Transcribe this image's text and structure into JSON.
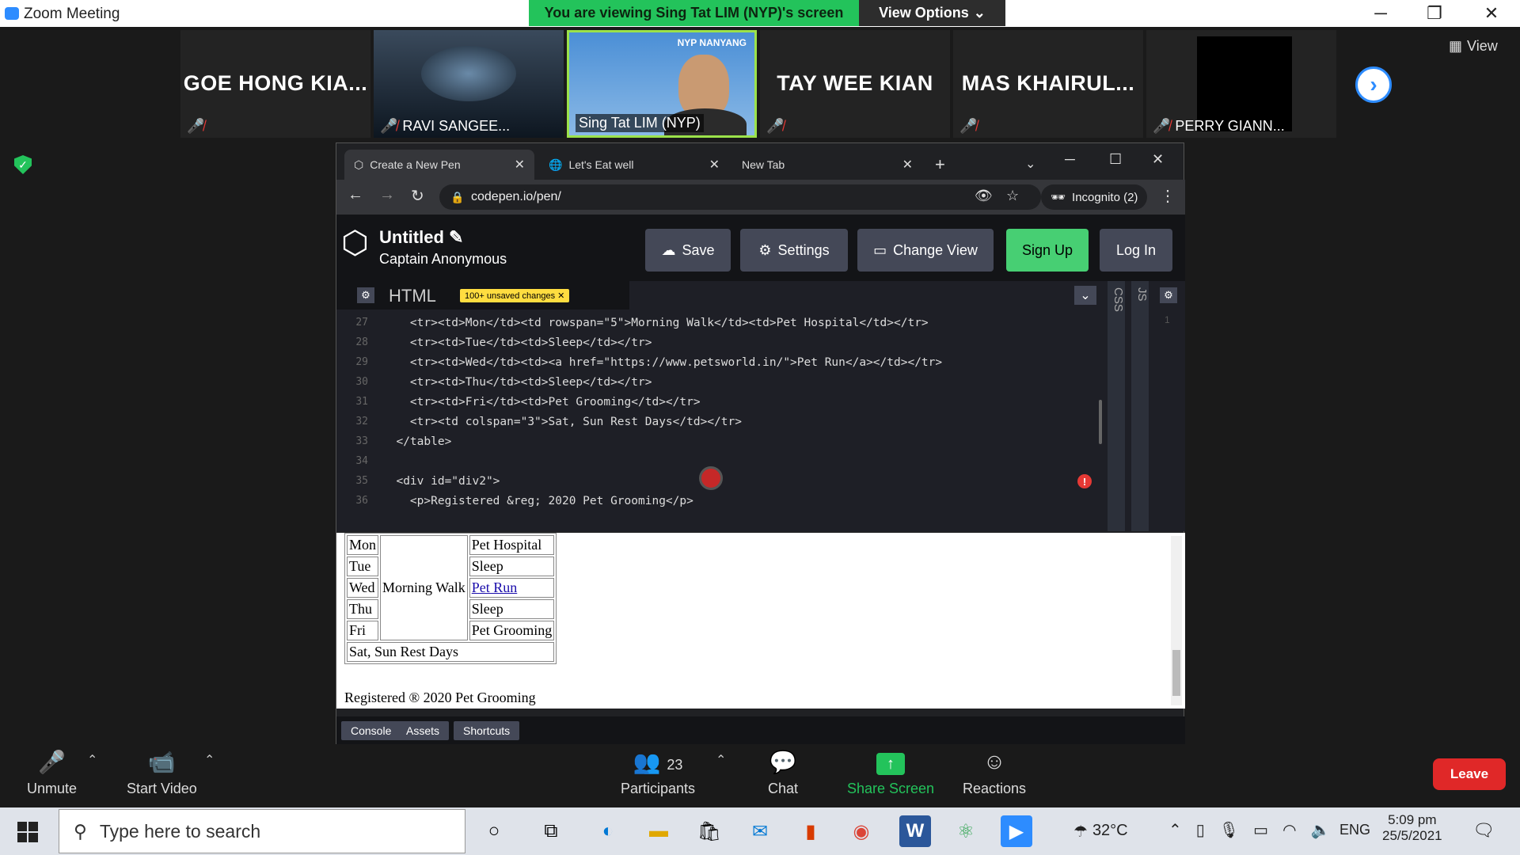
{
  "window": {
    "title": "Zoom Meeting",
    "min": "─",
    "max": "❐",
    "close": "✕"
  },
  "share": {
    "banner": "You are viewing Sing Tat LIM (NYP)'s screen",
    "view_options": "View Options"
  },
  "gallery": {
    "participants": [
      {
        "name": "GOE HONG KIA...",
        "muted": true
      },
      {
        "name": "RAVI SANGEE...",
        "muted": true
      },
      {
        "name": "Sing Tat LIM (NYP)",
        "muted": false
      },
      {
        "name": "TAY WEE KIAN",
        "muted": true
      },
      {
        "name": "MAS KHAIRUL...",
        "muted": true
      },
      {
        "name": "PERRY GIANN...",
        "muted": true
      }
    ],
    "view_label": "View",
    "logo_text": "NYP NANYANG"
  },
  "browser": {
    "tabs": [
      {
        "label": "Create a New Pen",
        "active": true
      },
      {
        "label": "Let's Eat well"
      },
      {
        "label": "New Tab"
      }
    ],
    "url": "codepen.io/pen/",
    "incognito": "Incognito (2)"
  },
  "codepen": {
    "title": "Untitled",
    "author": "Captain Anonymous",
    "buttons": {
      "save": "Save",
      "settings": "Settings",
      "change_view": "Change View",
      "signup": "Sign Up",
      "login": "Log In"
    },
    "editor_label": "HTML",
    "unsaved": "100+ unsaved changes",
    "side_tabs": [
      "CSS",
      "JS"
    ],
    "js_line": "1",
    "lines": [
      {
        "n": "27",
        "t": "    <tr><td>Mon</td><td rowspan=\"5\">Morning Walk</td><td>Pet Hospital</td></tr>"
      },
      {
        "n": "28",
        "t": "    <tr><td>Tue</td><td>Sleep</td></tr>"
      },
      {
        "n": "29",
        "t": "    <tr><td>Wed</td><td><a href=\"https://www.petsworld.in/\">Pet Run</a></td></tr>"
      },
      {
        "n": "30",
        "t": "    <tr><td>Thu</td><td>Sleep</td></tr>"
      },
      {
        "n": "31",
        "t": "    <tr><td>Fri</td><td>Pet Grooming</td></tr>"
      },
      {
        "n": "32",
        "t": "    <tr><td colspan=\"3\">Sat, Sun Rest Days</td></tr>"
      },
      {
        "n": "33",
        "t": "  </table>"
      },
      {
        "n": "34",
        "t": ""
      },
      {
        "n": "35",
        "t": "  <div id=\"div2\">"
      },
      {
        "n": "36",
        "t": "    <p>Registered &reg; 2020 Pet Grooming</p>"
      }
    ],
    "footer": [
      "Console",
      "Assets",
      "Shortcuts"
    ]
  },
  "preview": {
    "rows": [
      [
        "Mon",
        "Pet Hospital"
      ],
      [
        "Tue",
        "Sleep"
      ],
      [
        "Wed",
        "Pet Run"
      ],
      [
        "Thu",
        "Sleep"
      ],
      [
        "Fri",
        "Pet Grooming"
      ]
    ],
    "merged": "Morning Walk",
    "rest": "Sat, Sun Rest Days",
    "footer": "Registered ® 2020 Pet Grooming"
  },
  "controls": {
    "unmute": "Unmute",
    "start_video": "Start Video",
    "participants": "Participants",
    "participant_count": "23",
    "chat": "Chat",
    "share_screen": "Share Screen",
    "reactions": "Reactions",
    "leave": "Leave"
  },
  "taskbar": {
    "search_placeholder": "Type here to search",
    "weather": "32°C",
    "lang": "ENG",
    "time": "5:09 pm",
    "date": "25/5/2021"
  },
  "colors": {
    "zoom_blue": "#2d8cff",
    "share_green": "#23c35b",
    "leave_red": "#e02828",
    "signup_green": "#47cf73"
  }
}
